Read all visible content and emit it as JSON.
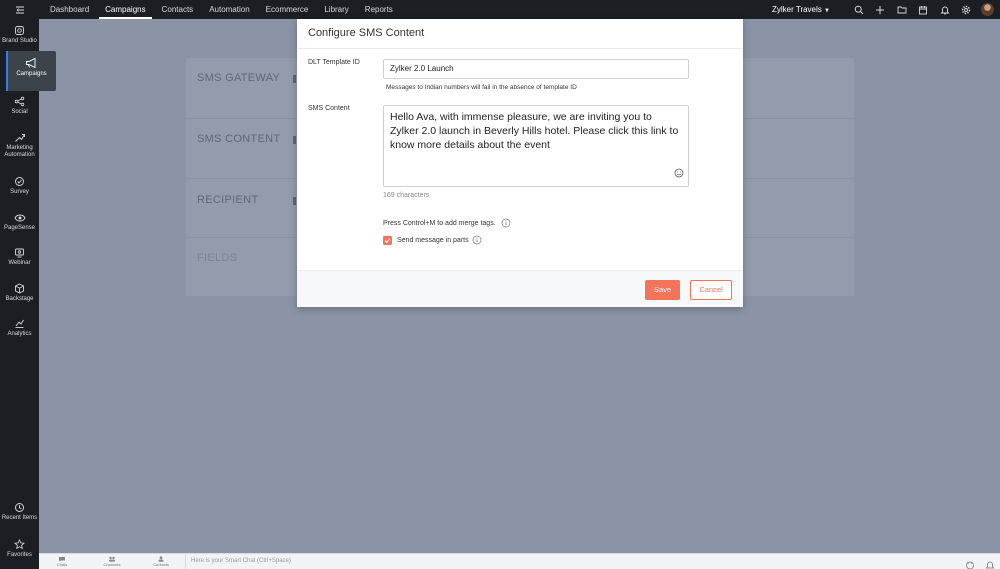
{
  "topnav": {
    "items": [
      "Dashboard",
      "Campaigns",
      "Contacts",
      "Automation",
      "Ecommerce",
      "Library",
      "Reports"
    ],
    "active": "Campaigns",
    "org_name": "Zylker Travels",
    "icons": [
      "search-icon",
      "add-icon",
      "folder-icon",
      "calendar-icon",
      "bell-icon",
      "gear-icon",
      "user-avatar"
    ]
  },
  "sidebar": {
    "items": [
      {
        "label": "Brand Studio",
        "icon": "brand-studio-icon"
      },
      {
        "label": "Campaigns",
        "icon": "megaphone-icon"
      },
      {
        "label": "Social",
        "icon": "social-icon"
      },
      {
        "label": "Marketing Automation",
        "icon": "automation-icon"
      },
      {
        "label": "Survey",
        "icon": "survey-icon"
      },
      {
        "label": "PageSense",
        "icon": "pagesense-icon"
      },
      {
        "label": "Webinar",
        "icon": "webinar-icon"
      },
      {
        "label": "Backstage",
        "icon": "backstage-icon"
      },
      {
        "label": "Analytics",
        "icon": "analytics-icon"
      }
    ],
    "bottom": [
      {
        "label": "Recent Items",
        "icon": "history-icon"
      },
      {
        "label": "Favorites",
        "icon": "star-icon"
      }
    ]
  },
  "background_page": {
    "sections": [
      "SMS GATEWAY",
      "SMS CONTENT",
      "RECIPIENT",
      "FIELDS"
    ]
  },
  "bottombar": {
    "items": [
      "Chats",
      "Channels",
      "Contacts"
    ],
    "smart_chat_placeholder": "Here is your Smart Chat (Ctrl+Space)"
  },
  "modal": {
    "title": "Configure SMS Content",
    "dlt_label": "DLT Template ID",
    "dlt_value": "Zylker 2.0 Launch",
    "dlt_hint": "Messages to Indian numbers will fail in the absence of template ID",
    "sms_label": "SMS Content",
    "sms_value": "Hello Ava, with immense pleasure, we are inviting you to Zylker 2.0 launch in Beverly Hills hotel. Please click this link to know more details about the event",
    "char_count": "169 characters",
    "merge_hint": "Press Control+M to add merge tags.",
    "send_parts_label": "Send message in parts",
    "send_parts_checked": true,
    "save_label": "Save",
    "cancel_label": "Cancel"
  },
  "colors": {
    "accent": "#f4735b",
    "nav_bg": "#1b1f24",
    "overlay": "#8a94a6"
  }
}
